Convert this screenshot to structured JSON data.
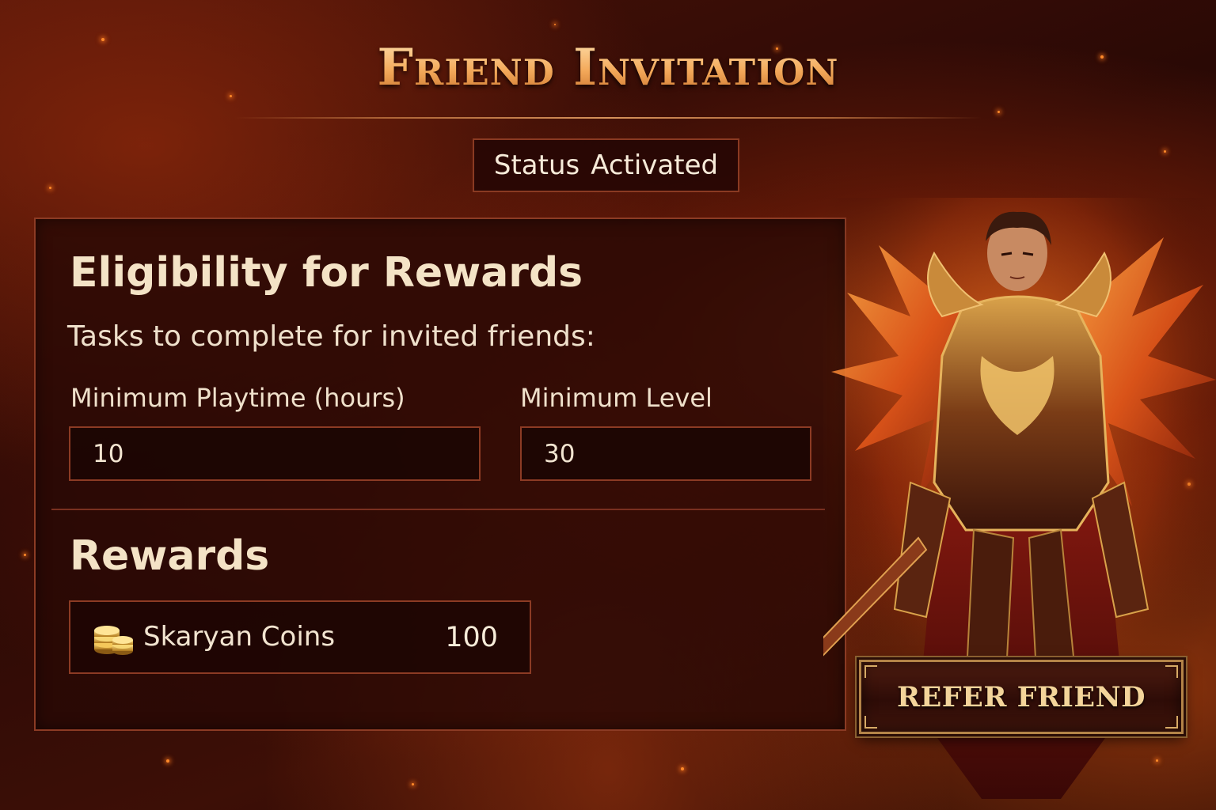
{
  "page": {
    "title": "Friend Invitation"
  },
  "status": {
    "label": "Status",
    "value": "Activated"
  },
  "eligibility": {
    "heading": "Eligibility for Rewards",
    "subheading": "Tasks to complete for invited friends:",
    "fields": [
      {
        "label": "Minimum Playtime (hours)",
        "value": "10"
      },
      {
        "label": "Minimum Level",
        "value": "30"
      }
    ]
  },
  "rewards": {
    "heading": "Rewards",
    "items": [
      {
        "icon": "gold-coins-icon",
        "name": "Skaryan Coins",
        "amount": "100"
      }
    ]
  },
  "actions": {
    "refer_label": "REFER FRIEND"
  },
  "colors": {
    "accent": "#f3a95a",
    "panel_border": "#8c3b24",
    "button_border": "#b48448"
  }
}
